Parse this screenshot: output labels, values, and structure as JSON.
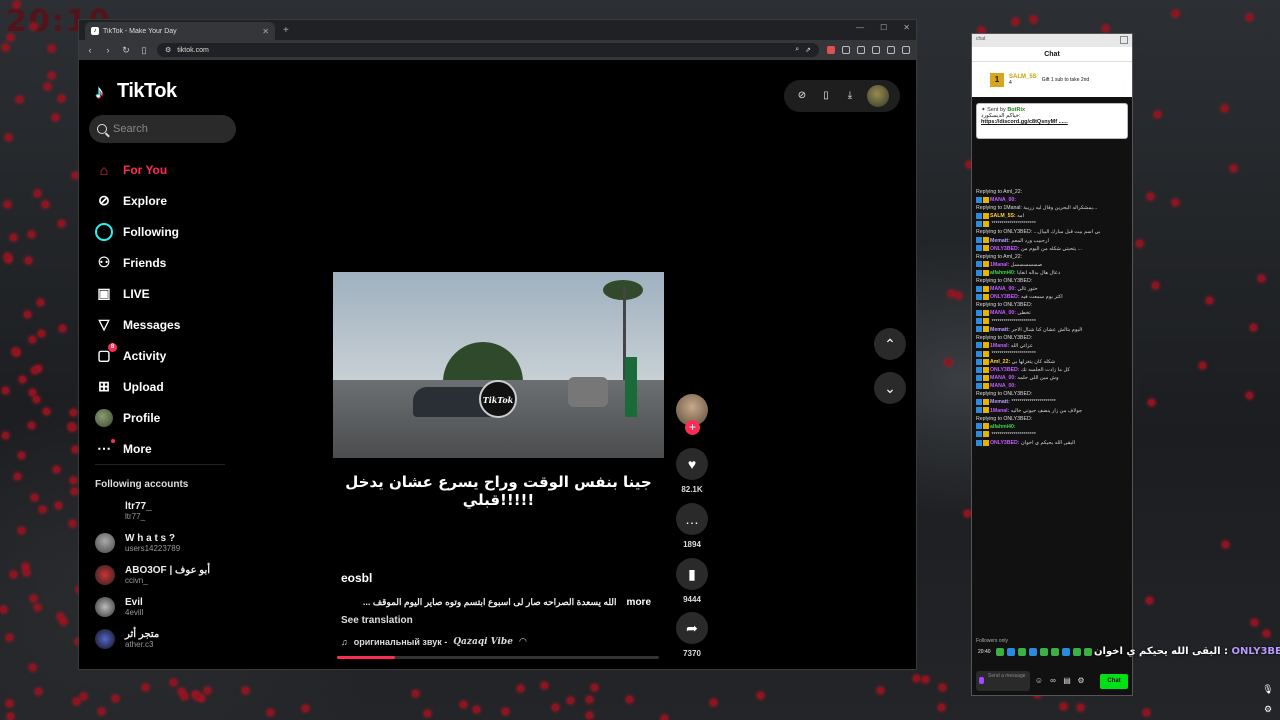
{
  "stream_overlay": {
    "clock": "20:10"
  },
  "browser": {
    "tab_title": "TikTok - Make Your Day",
    "new_tab": "+",
    "url": "tiktok.com"
  },
  "tiktok": {
    "logo": "TikTok",
    "search_placeholder": "Search",
    "nav": [
      {
        "label": "For You",
        "icon": "home-icon",
        "active": true
      },
      {
        "label": "Explore",
        "icon": "compass-icon"
      },
      {
        "label": "Following",
        "icon": "following-icon"
      },
      {
        "label": "Friends",
        "icon": "friends-icon"
      },
      {
        "label": "LIVE",
        "icon": "live-icon"
      },
      {
        "label": "Messages",
        "icon": "messages-icon"
      },
      {
        "label": "Activity",
        "icon": "activity-icon",
        "badge": "8"
      },
      {
        "label": "Upload",
        "icon": "upload-icon"
      },
      {
        "label": "Profile",
        "icon": "profile-avatar"
      },
      {
        "label": "More",
        "icon": "more-icon"
      }
    ],
    "following_accounts_title": "Following accounts",
    "following_accounts": [
      {
        "name": "ltr77_",
        "handle": "ltr77_"
      },
      {
        "name": "W h a t s ?",
        "handle": "users14223789"
      },
      {
        "name": "ABO3OF | أبو عوف",
        "handle": "ccivn_"
      },
      {
        "name": "Evil",
        "handle": "4evill"
      },
      {
        "name": "متجر أثر",
        "handle": "ather.c3"
      }
    ],
    "video": {
      "watermark": "TikTok",
      "caption": "جينا بنفس الوقت وراح يسرع عشان يدخل قبلي!!!!!",
      "author": "eosbl",
      "description": "الله يسعدة الصراحه صار لى اسبوع ابتسم وتوه صاير اليوم الموقف ...",
      "more": "more",
      "see_translation": "See translation",
      "sound_title": "оригинальный звук -",
      "sound_artist": "Qazaqi Vibe",
      "progress": 0.18
    },
    "actions": {
      "likes": "82.1K",
      "comments": "1894",
      "saves": "9444",
      "shares": "7370"
    }
  },
  "chat": {
    "window_title": "chat",
    "header": "Chat",
    "top_gifter": {
      "rank": "1",
      "name": "SALM_5S",
      "count": "4",
      "note": "Gift 1 sub to take 2nd"
    },
    "pinned": {
      "sent_by": "Sent by",
      "bot": "BotRix",
      "line1": "حياكم الديسكورد:",
      "link": "https://discord.gg/c8tQsnyMf ......"
    },
    "messages": [
      {
        "reply": "Replying to Aml_22:",
        "user": "MANA_00:",
        "color": "#c25bff",
        "text": ""
      },
      {
        "reply": "Replying to 1Manal: يمشكراله البحرين وقال ليه زريبة...",
        "user": "SALM_5S:",
        "color": "#ffd23a",
        "text": "امه"
      },
      {
        "reply": "",
        "user": "",
        "color": "#ddd",
        "text": "**********************"
      },
      {
        "reply": "Replying to ONLY3BED: ...بي اسم بيت قبل مبارك البيال",
        "user": "Mematt:",
        "color": "#b99aff",
        "text": "ارحبيب ورد المعم"
      },
      {
        "reply": "",
        "user": "ONLY3BED:",
        "color": "#c25bff",
        "text": "يتحيتي شكله من اليوم من ..."
      },
      {
        "reply": "Replying to Aml_22:",
        "user": "1Manal:",
        "color": "#c25bff",
        "text": "صسسسسسل"
      },
      {
        "reply": "",
        "user": "alfahmi40:",
        "color": "#3cd34b",
        "text": "دعال هال بداله انغابا"
      },
      {
        "reply": "Replying to ONLY3BED:",
        "user": "MANA_00:",
        "color": "#c25bff",
        "text": "حتور تالي"
      },
      {
        "reply": "",
        "user": "ONLY3BED:",
        "color": "#c25bff",
        "text": "اكثر يوم سمعت فيه"
      },
      {
        "reply": "Replying to ONLY3BED:",
        "user": "MANA_00:",
        "color": "#c25bff",
        "text": "تخطى"
      },
      {
        "reply": "",
        "user": "",
        "color": "#ddd",
        "text": "**********************"
      },
      {
        "reply": "",
        "user": "Mematt:",
        "color": "#b99aff",
        "text": "اليوم بتالش عشان كنا شنال الاجر"
      },
      {
        "reply": "Replying to ONLY3BED:",
        "user": "1Manal:",
        "color": "#c25bff",
        "text": "عزائي الله"
      },
      {
        "reply": "",
        "user": "",
        "color": "#ddd",
        "text": "**********************"
      },
      {
        "reply": "",
        "user": "Aml_22:",
        "color": "#ffd23a",
        "text": "شكله كان يتغزلها بي"
      },
      {
        "reply": "",
        "user": "ONLY3BED:",
        "color": "#c25bff",
        "text": "كل ما زادت الجلسه تك"
      },
      {
        "reply": "",
        "user": "MANA_00:",
        "color": "#c25bff",
        "text": "وش مين اللي حلمه"
      },
      {
        "reply": "",
        "user": "MANA_00:",
        "color": "#c25bff",
        "text": ""
      },
      {
        "reply": "Replying to ONLY3BED:",
        "user": "Mematt:",
        "color": "#b99aff",
        "text": "**********************"
      },
      {
        "reply": "",
        "user": "1Manal:",
        "color": "#c25bff",
        "text": "جولاف من زار ينضف حيوتي خاليه"
      },
      {
        "reply": "Replying to ONLY3BED:",
        "user": "alfahmi40:",
        "color": "#3cd34b",
        "text": ""
      },
      {
        "reply": "",
        "user": "",
        "color": "#ddd",
        "text": "**********************"
      },
      {
        "reply": "",
        "user": "ONLY3BED:",
        "color": "#c25bff",
        "text": "اليقى الله يحيكم ي اخوان"
      }
    ],
    "followers_only": "Followers only",
    "time": "20:40",
    "input_placeholder": "Send a message",
    "chat_button": "Chat"
  },
  "overlay_message": {
    "text": "البقى الله يحيكم ي اخوان :",
    "user": "ONLY3BED"
  }
}
